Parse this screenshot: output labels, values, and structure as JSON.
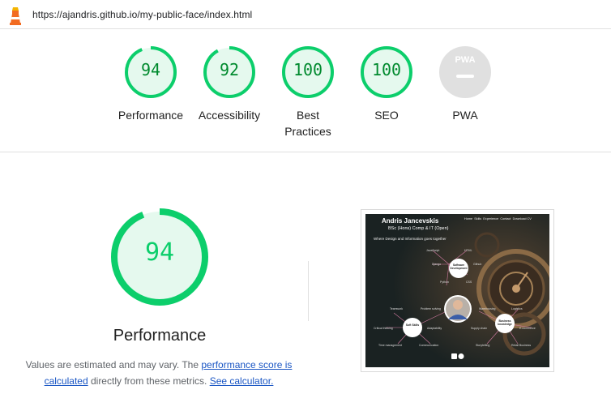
{
  "url": "https://ajandris.github.io/my-public-face/index.html",
  "categories": [
    {
      "score": "94",
      "label": "Performance",
      "value": 94
    },
    {
      "score": "92",
      "label": "Accessibility",
      "value": 92
    },
    {
      "score": "100",
      "label": "Best Practices",
      "value": 100
    },
    {
      "score": "100",
      "label": "SEO",
      "value": 100
    },
    {
      "score": "",
      "label": "PWA",
      "value": null
    }
  ],
  "pwa_badge": "PWA",
  "detail": {
    "score": "94",
    "value": 94,
    "title": "Performance",
    "note_text_1": "Values are estimated and may vary. The ",
    "note_link_1": "performance score is calculated",
    "note_text_2": " directly from these metrics. ",
    "note_link_2": "See calculator."
  },
  "thumbnail": {
    "name": "Andris Jancevskis",
    "degree": "BSc (Hons) Comp & IT (Open)",
    "tagline": "Where Design and Information goes together",
    "nav": [
      "Home",
      "Skills",
      "Experience",
      "Contact",
      "Download CV"
    ],
    "bubbles": [
      "Software Development",
      "Soft Skills",
      "Business knowledge"
    ],
    "words": [
      "JavaScript",
      "HTML",
      "Django",
      "Github",
      "CSS",
      "Python",
      "Teamwork",
      "Problem solving",
      "Warehousing",
      "Logistics",
      "Critical thinking",
      "Adaptability",
      "Supply chain",
      "E-commerce",
      "Time management",
      "Communication",
      "Storytelling",
      "Retail Business"
    ]
  },
  "colors": {
    "pass_ring": "#0cce6b",
    "pass_fill": "#e5f9ee",
    "pass_text": "#008a2e",
    "pwa_gray": "#e0e0e0"
  }
}
